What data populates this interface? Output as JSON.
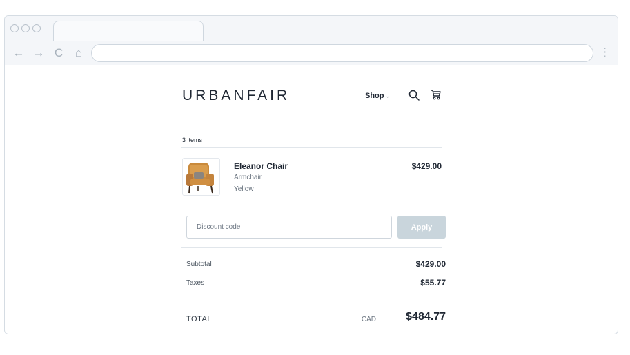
{
  "browser": {
    "icons": [
      "back-icon",
      "forward-icon",
      "reload-icon",
      "home-icon"
    ],
    "back": "←",
    "forward": "→",
    "reload": "C",
    "home": "⌂",
    "menu": "⋮"
  },
  "store": {
    "logo": "URBANFAIR",
    "nav": {
      "shop_label": "Shop",
      "shop_chevron": "⌄"
    }
  },
  "cart": {
    "item_count": "3 items",
    "items": [
      {
        "name": "Eleanor Chair",
        "type": "Armchair",
        "color": "Yellow",
        "price": "$429.00"
      }
    ],
    "discount": {
      "placeholder": "Discount code",
      "value": "",
      "apply_label": "Apply"
    },
    "summary": {
      "subtotal_label": "Subtotal",
      "subtotal_value": "$429.00",
      "taxes_label": "Taxes",
      "taxes_value": "$55.77"
    },
    "total": {
      "label": "TOTAL",
      "currency": "CAD",
      "value": "$484.77"
    }
  },
  "colors": {
    "accent_disabled": "#c9d5dc",
    "text": "#1f2733",
    "muted": "#6b7580"
  }
}
